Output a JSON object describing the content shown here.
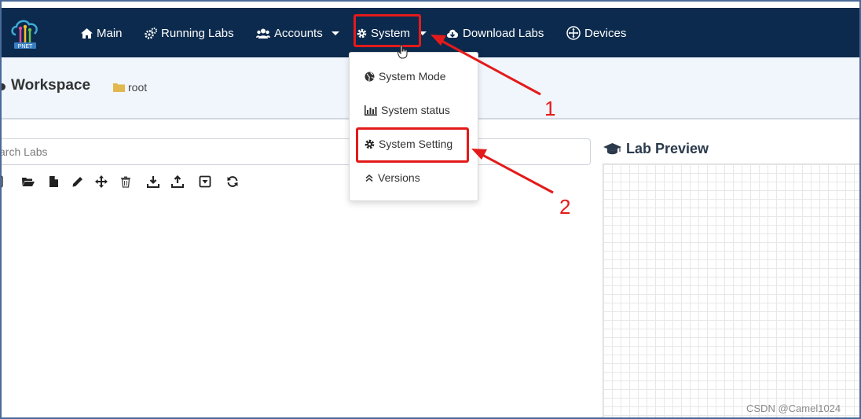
{
  "nav": {
    "logo_text": "PNET",
    "items": [
      {
        "label": "Main",
        "icon": "home-icon"
      },
      {
        "label": "Running Labs",
        "icon": "cogs-icon"
      },
      {
        "label": "Accounts",
        "icon": "users-icon"
      },
      {
        "label": "System",
        "icon": "gear-icon"
      },
      {
        "label": "Download Labs",
        "icon": "cloud-download-icon"
      },
      {
        "label": "Devices",
        "icon": "arrows-move-icon"
      }
    ]
  },
  "workspace": {
    "title": "Workspace",
    "breadcrumb_root": "root"
  },
  "search": {
    "visible_text": "arch Labs"
  },
  "toolbar": {
    "icons": [
      "open-folder-icon",
      "new-file-icon",
      "edit-icon",
      "move-icon",
      "delete-icon",
      "import-icon",
      "export-icon",
      "dropdown-toggle-icon",
      "refresh-icon"
    ]
  },
  "preview": {
    "title": "Lab Preview"
  },
  "dropdown": {
    "items": [
      {
        "label": "System Mode",
        "icon": "globe-icon"
      },
      {
        "label": "System status",
        "icon": "bar-chart-icon"
      },
      {
        "label": "System Setting",
        "icon": "gear-icon"
      },
      {
        "label": "Versions",
        "icon": "double-chevron-up-icon"
      }
    ]
  },
  "annotations": {
    "step1": "1",
    "step2": "2",
    "color": "#e41a1a"
  },
  "colors": {
    "navbar": "#0c2a4d",
    "subheader": "#f0f6fc"
  },
  "watermark": "CSDN @Camel1024"
}
